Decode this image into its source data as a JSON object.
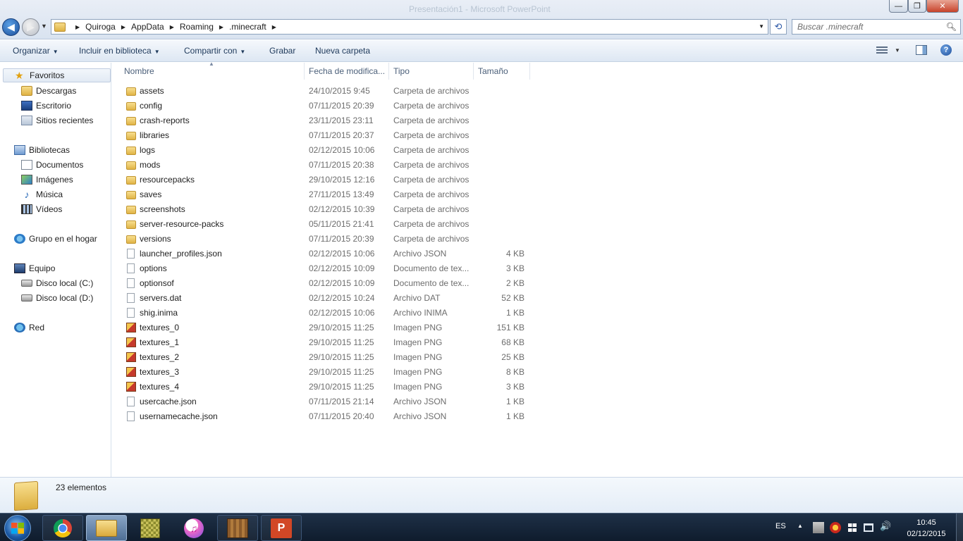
{
  "window": {
    "ghost_title": "Presentación1 - Microsoft PowerPoint",
    "minimize_glyph": "—",
    "maximize_glyph": "❐",
    "close_glyph": "✕"
  },
  "nav": {
    "back_glyph": "◀",
    "forward_glyph": "▶",
    "history_glyph": "▼"
  },
  "address": {
    "breadcrumbs": [
      "Quiroga",
      "AppData",
      "Roaming",
      ".minecraft"
    ],
    "separator": "▶",
    "dropdown_glyph": "▼",
    "refresh_glyph": "⟲"
  },
  "search": {
    "placeholder": "Buscar .minecraft",
    "icon": "search-icon"
  },
  "toolbar": {
    "organize": "Organizar",
    "include_library": "Incluir en biblioteca",
    "share": "Compartir con",
    "burn": "Grabar",
    "new_folder": "Nueva carpeta",
    "caret": "▼",
    "help": "?"
  },
  "sidebar": {
    "favorites": {
      "label": "Favoritos",
      "items": [
        "Descargas",
        "Escritorio",
        "Sitios recientes"
      ]
    },
    "libraries": {
      "label": "Bibliotecas",
      "items": [
        "Documentos",
        "Imágenes",
        "Música",
        "Vídeos"
      ]
    },
    "homegroup": {
      "label": "Grupo en el hogar"
    },
    "computer": {
      "label": "Equipo",
      "items": [
        "Disco local (C:)",
        "Disco local (D:)"
      ]
    },
    "network": {
      "label": "Red"
    }
  },
  "columns": {
    "name": "Nombre",
    "date": "Fecha de modifica...",
    "type": "Tipo",
    "size": "Tamaño",
    "sort_glyph": "▲"
  },
  "files": [
    {
      "name": "assets",
      "date": "24/10/2015 9:45",
      "type": "Carpeta de archivos",
      "size": "",
      "kind": "folder"
    },
    {
      "name": "config",
      "date": "07/11/2015 20:39",
      "type": "Carpeta de archivos",
      "size": "",
      "kind": "folder"
    },
    {
      "name": "crash-reports",
      "date": "23/11/2015 23:11",
      "type": "Carpeta de archivos",
      "size": "",
      "kind": "folder"
    },
    {
      "name": "libraries",
      "date": "07/11/2015 20:37",
      "type": "Carpeta de archivos",
      "size": "",
      "kind": "folder"
    },
    {
      "name": "logs",
      "date": "02/12/2015 10:06",
      "type": "Carpeta de archivos",
      "size": "",
      "kind": "folder"
    },
    {
      "name": "mods",
      "date": "07/11/2015 20:38",
      "type": "Carpeta de archivos",
      "size": "",
      "kind": "folder"
    },
    {
      "name": "resourcepacks",
      "date": "29/10/2015 12:16",
      "type": "Carpeta de archivos",
      "size": "",
      "kind": "folder"
    },
    {
      "name": "saves",
      "date": "27/11/2015 13:49",
      "type": "Carpeta de archivos",
      "size": "",
      "kind": "folder"
    },
    {
      "name": "screenshots",
      "date": "02/12/2015 10:39",
      "type": "Carpeta de archivos",
      "size": "",
      "kind": "folder"
    },
    {
      "name": "server-resource-packs",
      "date": "05/11/2015 21:41",
      "type": "Carpeta de archivos",
      "size": "",
      "kind": "folder"
    },
    {
      "name": "versions",
      "date": "07/11/2015 20:39",
      "type": "Carpeta de archivos",
      "size": "",
      "kind": "folder"
    },
    {
      "name": "launcher_profiles.json",
      "date": "02/12/2015 10:06",
      "type": "Archivo JSON",
      "size": "4 KB",
      "kind": "file"
    },
    {
      "name": "options",
      "date": "02/12/2015 10:09",
      "type": "Documento de tex...",
      "size": "3 KB",
      "kind": "file"
    },
    {
      "name": "optionsof",
      "date": "02/12/2015 10:09",
      "type": "Documento de tex...",
      "size": "2 KB",
      "kind": "file"
    },
    {
      "name": "servers.dat",
      "date": "02/12/2015 10:24",
      "type": "Archivo DAT",
      "size": "52 KB",
      "kind": "file"
    },
    {
      "name": "shig.inima",
      "date": "02/12/2015 10:06",
      "type": "Archivo INIMA",
      "size": "1 KB",
      "kind": "file"
    },
    {
      "name": "textures_0",
      "date": "29/10/2015 11:25",
      "type": "Imagen PNG",
      "size": "151 KB",
      "kind": "png"
    },
    {
      "name": "textures_1",
      "date": "29/10/2015 11:25",
      "type": "Imagen PNG",
      "size": "68 KB",
      "kind": "png"
    },
    {
      "name": "textures_2",
      "date": "29/10/2015 11:25",
      "type": "Imagen PNG",
      "size": "25 KB",
      "kind": "png"
    },
    {
      "name": "textures_3",
      "date": "29/10/2015 11:25",
      "type": "Imagen PNG",
      "size": "8 KB",
      "kind": "png"
    },
    {
      "name": "textures_4",
      "date": "29/10/2015 11:25",
      "type": "Imagen PNG",
      "size": "3 KB",
      "kind": "png"
    },
    {
      "name": "usercache.json",
      "date": "07/11/2015 21:14",
      "type": "Archivo JSON",
      "size": "1 KB",
      "kind": "file"
    },
    {
      "name": "usernamecache.json",
      "date": "07/11/2015 20:40",
      "type": "Archivo JSON",
      "size": "1 KB",
      "kind": "file"
    }
  ],
  "details": {
    "item_count": "23 elementos"
  },
  "taskbar": {
    "apps": [
      "chrome",
      "explorer",
      "minecraft-launcher",
      "itunes",
      "minecraft",
      "powerpoint"
    ],
    "powerpoint_glyph": "P",
    "itunes_glyph": "♫",
    "lang": "ES",
    "tray_arrow": "▲",
    "volume_glyph": "🔊",
    "time": "10:45",
    "date": "02/12/2015"
  }
}
